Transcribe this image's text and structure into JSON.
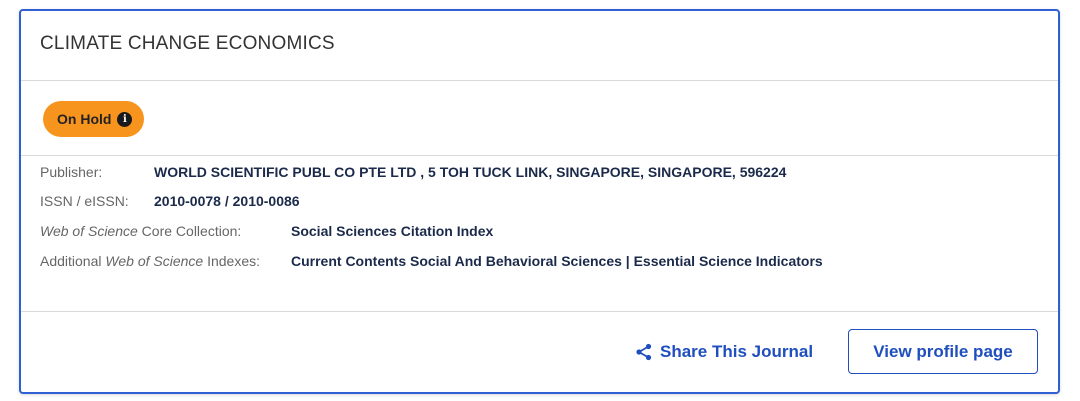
{
  "journal": {
    "title": "CLIMATE CHANGE ECONOMICS"
  },
  "status": {
    "label": "On Hold",
    "icon": "info-icon"
  },
  "details": {
    "publisher": {
      "label": "Publisher:",
      "value": "WORLD SCIENTIFIC PUBL CO PTE LTD , 5 TOH TUCK LINK, SINGAPORE, SINGAPORE, 596224"
    },
    "issn": {
      "label": "ISSN / eISSN:",
      "value": "2010-0078 / 2010-0086"
    },
    "core": {
      "label_italic": "Web of Science",
      "label_rest": " Core Collection:",
      "value": "Social Sciences Citation Index"
    },
    "additional": {
      "label_prefix": "Additional ",
      "label_italic": "Web of Science",
      "label_rest": " Indexes:",
      "value": "Current Contents Social And Behavioral Sciences | Essential Science Indicators"
    }
  },
  "actions": {
    "share_label": "Share This Journal",
    "share_icon": "share-icon",
    "view_label": "View profile page"
  },
  "colors": {
    "accent": "#1f4fbf",
    "badge": "#f7941d",
    "border": "#2f5fd3"
  }
}
